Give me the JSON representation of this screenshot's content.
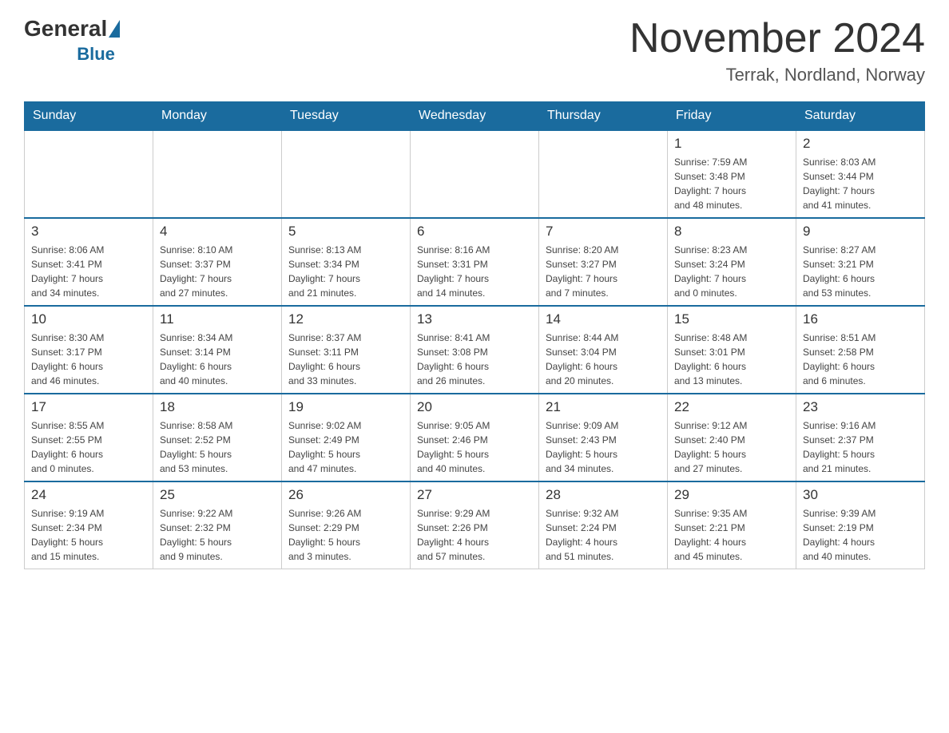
{
  "header": {
    "logo_general": "General",
    "logo_blue": "Blue",
    "month_title": "November 2024",
    "location": "Terrak, Nordland, Norway"
  },
  "days_of_week": [
    "Sunday",
    "Monday",
    "Tuesday",
    "Wednesday",
    "Thursday",
    "Friday",
    "Saturday"
  ],
  "weeks": [
    [
      {
        "day": "",
        "info": ""
      },
      {
        "day": "",
        "info": ""
      },
      {
        "day": "",
        "info": ""
      },
      {
        "day": "",
        "info": ""
      },
      {
        "day": "",
        "info": ""
      },
      {
        "day": "1",
        "info": "Sunrise: 7:59 AM\nSunset: 3:48 PM\nDaylight: 7 hours\nand 48 minutes."
      },
      {
        "day": "2",
        "info": "Sunrise: 8:03 AM\nSunset: 3:44 PM\nDaylight: 7 hours\nand 41 minutes."
      }
    ],
    [
      {
        "day": "3",
        "info": "Sunrise: 8:06 AM\nSunset: 3:41 PM\nDaylight: 7 hours\nand 34 minutes."
      },
      {
        "day": "4",
        "info": "Sunrise: 8:10 AM\nSunset: 3:37 PM\nDaylight: 7 hours\nand 27 minutes."
      },
      {
        "day": "5",
        "info": "Sunrise: 8:13 AM\nSunset: 3:34 PM\nDaylight: 7 hours\nand 21 minutes."
      },
      {
        "day": "6",
        "info": "Sunrise: 8:16 AM\nSunset: 3:31 PM\nDaylight: 7 hours\nand 14 minutes."
      },
      {
        "day": "7",
        "info": "Sunrise: 8:20 AM\nSunset: 3:27 PM\nDaylight: 7 hours\nand 7 minutes."
      },
      {
        "day": "8",
        "info": "Sunrise: 8:23 AM\nSunset: 3:24 PM\nDaylight: 7 hours\nand 0 minutes."
      },
      {
        "day": "9",
        "info": "Sunrise: 8:27 AM\nSunset: 3:21 PM\nDaylight: 6 hours\nand 53 minutes."
      }
    ],
    [
      {
        "day": "10",
        "info": "Sunrise: 8:30 AM\nSunset: 3:17 PM\nDaylight: 6 hours\nand 46 minutes."
      },
      {
        "day": "11",
        "info": "Sunrise: 8:34 AM\nSunset: 3:14 PM\nDaylight: 6 hours\nand 40 minutes."
      },
      {
        "day": "12",
        "info": "Sunrise: 8:37 AM\nSunset: 3:11 PM\nDaylight: 6 hours\nand 33 minutes."
      },
      {
        "day": "13",
        "info": "Sunrise: 8:41 AM\nSunset: 3:08 PM\nDaylight: 6 hours\nand 26 minutes."
      },
      {
        "day": "14",
        "info": "Sunrise: 8:44 AM\nSunset: 3:04 PM\nDaylight: 6 hours\nand 20 minutes."
      },
      {
        "day": "15",
        "info": "Sunrise: 8:48 AM\nSunset: 3:01 PM\nDaylight: 6 hours\nand 13 minutes."
      },
      {
        "day": "16",
        "info": "Sunrise: 8:51 AM\nSunset: 2:58 PM\nDaylight: 6 hours\nand 6 minutes."
      }
    ],
    [
      {
        "day": "17",
        "info": "Sunrise: 8:55 AM\nSunset: 2:55 PM\nDaylight: 6 hours\nand 0 minutes."
      },
      {
        "day": "18",
        "info": "Sunrise: 8:58 AM\nSunset: 2:52 PM\nDaylight: 5 hours\nand 53 minutes."
      },
      {
        "day": "19",
        "info": "Sunrise: 9:02 AM\nSunset: 2:49 PM\nDaylight: 5 hours\nand 47 minutes."
      },
      {
        "day": "20",
        "info": "Sunrise: 9:05 AM\nSunset: 2:46 PM\nDaylight: 5 hours\nand 40 minutes."
      },
      {
        "day": "21",
        "info": "Sunrise: 9:09 AM\nSunset: 2:43 PM\nDaylight: 5 hours\nand 34 minutes."
      },
      {
        "day": "22",
        "info": "Sunrise: 9:12 AM\nSunset: 2:40 PM\nDaylight: 5 hours\nand 27 minutes."
      },
      {
        "day": "23",
        "info": "Sunrise: 9:16 AM\nSunset: 2:37 PM\nDaylight: 5 hours\nand 21 minutes."
      }
    ],
    [
      {
        "day": "24",
        "info": "Sunrise: 9:19 AM\nSunset: 2:34 PM\nDaylight: 5 hours\nand 15 minutes."
      },
      {
        "day": "25",
        "info": "Sunrise: 9:22 AM\nSunset: 2:32 PM\nDaylight: 5 hours\nand 9 minutes."
      },
      {
        "day": "26",
        "info": "Sunrise: 9:26 AM\nSunset: 2:29 PM\nDaylight: 5 hours\nand 3 minutes."
      },
      {
        "day": "27",
        "info": "Sunrise: 9:29 AM\nSunset: 2:26 PM\nDaylight: 4 hours\nand 57 minutes."
      },
      {
        "day": "28",
        "info": "Sunrise: 9:32 AM\nSunset: 2:24 PM\nDaylight: 4 hours\nand 51 minutes."
      },
      {
        "day": "29",
        "info": "Sunrise: 9:35 AM\nSunset: 2:21 PM\nDaylight: 4 hours\nand 45 minutes."
      },
      {
        "day": "30",
        "info": "Sunrise: 9:39 AM\nSunset: 2:19 PM\nDaylight: 4 hours\nand 40 minutes."
      }
    ]
  ]
}
